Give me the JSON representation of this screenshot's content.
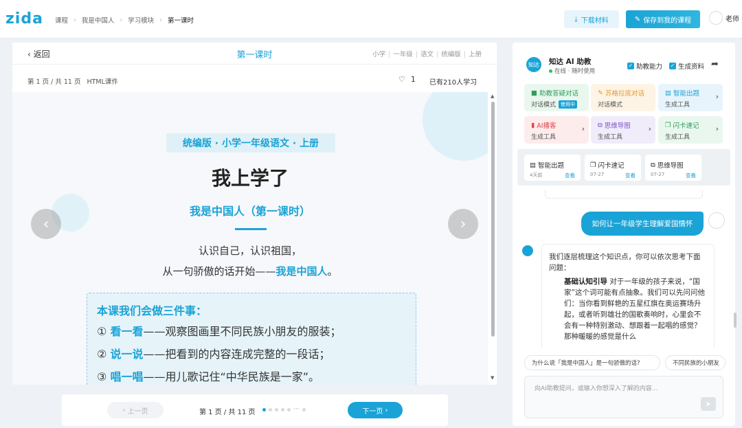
{
  "app": {
    "logo": "zida",
    "breadcrumbs": [
      "课程",
      "我是中国人",
      "学习模块",
      "第一课时"
    ],
    "download_label": "下载材料",
    "save_label": "保存到我的课程",
    "user_name": "老师"
  },
  "lesson": {
    "back_label": "返回",
    "title": "第一课时",
    "tags": [
      "小学",
      "一年级",
      "语文",
      "统编版",
      "上册"
    ],
    "page_info": "第 1 页 / 共 11 页",
    "format": "HTML课件",
    "likes": "1",
    "learners": "已有210人学习"
  },
  "slide": {
    "subtitle": "统编版 · 小学一年级语文 · 上册",
    "title": "我上学了",
    "heading": "我是中国人（第一课时）",
    "line1": "认识自己，认识祖国，",
    "line2_prefix": "从一句骄傲的话开始——",
    "line2_emph": "我是中国人",
    "line2_suffix": "。",
    "tasks_heading": "本课我们会做三件事：",
    "tasks": [
      {
        "num": "①",
        "verb": "看一看",
        "rest": "——观察图画里不同民族小朋友的服装；"
      },
      {
        "num": "②",
        "verb": "说一说",
        "rest": "——把看到的内容连成完整的一段话；"
      },
      {
        "num": "③",
        "verb": "唱一唱",
        "rest": "——用儿歌记住“中华民族是一家”。"
      }
    ]
  },
  "pager": {
    "prev_label": "上一页",
    "count": "第 1 页 / 共 11 页",
    "next_label": "下一页",
    "ellipsis": "···"
  },
  "assistant": {
    "name": "知达 AI 助教",
    "status": "在线 · 随时使用",
    "avatar_text": "知达",
    "check1": "助教能力",
    "check2": "生成资料",
    "tools": [
      {
        "name": "助教答疑对话",
        "sub": "对话模式",
        "badge": "使用中",
        "color": "#2e9e5b",
        "bg": "#eaf7ef",
        "icon": "chat-icon"
      },
      {
        "name": "苏格拉底对话",
        "sub": "对话模式",
        "badge": "",
        "color": "#e39a2c",
        "bg": "#fdf4e6",
        "icon": "bulb-icon"
      },
      {
        "name": "智能出题",
        "sub": "生成工具",
        "badge": "",
        "color": "#1aa3d6",
        "bg": "#e8f4fb",
        "icon": "doc-icon"
      },
      {
        "name": "AI播客",
        "sub": "生成工具",
        "badge": "",
        "color": "#e0464e",
        "bg": "#fdecec",
        "icon": "mic-icon"
      },
      {
        "name": "思维导图",
        "sub": "生成工具",
        "badge": "",
        "color": "#7c55c7",
        "bg": "#f1ecfa",
        "icon": "mindmap-icon"
      },
      {
        "name": "闪卡速记",
        "sub": "生成工具",
        "badge": "",
        "color": "#2e9e5b",
        "bg": "#eaf7ef",
        "icon": "card-icon"
      }
    ],
    "history": [
      {
        "name": "智能出题",
        "date": "4天前",
        "view": "查看"
      },
      {
        "name": "闪卡速记",
        "date": "07-27",
        "view": "查看"
      },
      {
        "name": "思维导图",
        "date": "07-27",
        "view": "查看"
      }
    ],
    "user_message": "如何让一年级学生理解爱国情怀",
    "bot_intro": "我们逐层梳理这个知识点，你可以依次思考下面问题：",
    "bot_point_title": "基础认知引导",
    "bot_point_body": "对于一年级的孩子来说，“国家”这个词可能有点抽象。我们可以先问问他们：当你看到鲜艳的五星红旗在奥运赛场升起，或者听到雄壮的国歌奏响时，心里会不会有一种特别激动、想跟着一起唱的感觉？那种暖暖的感觉是什么",
    "suggestions": [
      "为什么说「我是中国人」是一句骄傲的话?",
      "不同民族的小朋友"
    ],
    "input_placeholder": "向AI助教提问，或输入你想深入了解的内容..."
  }
}
